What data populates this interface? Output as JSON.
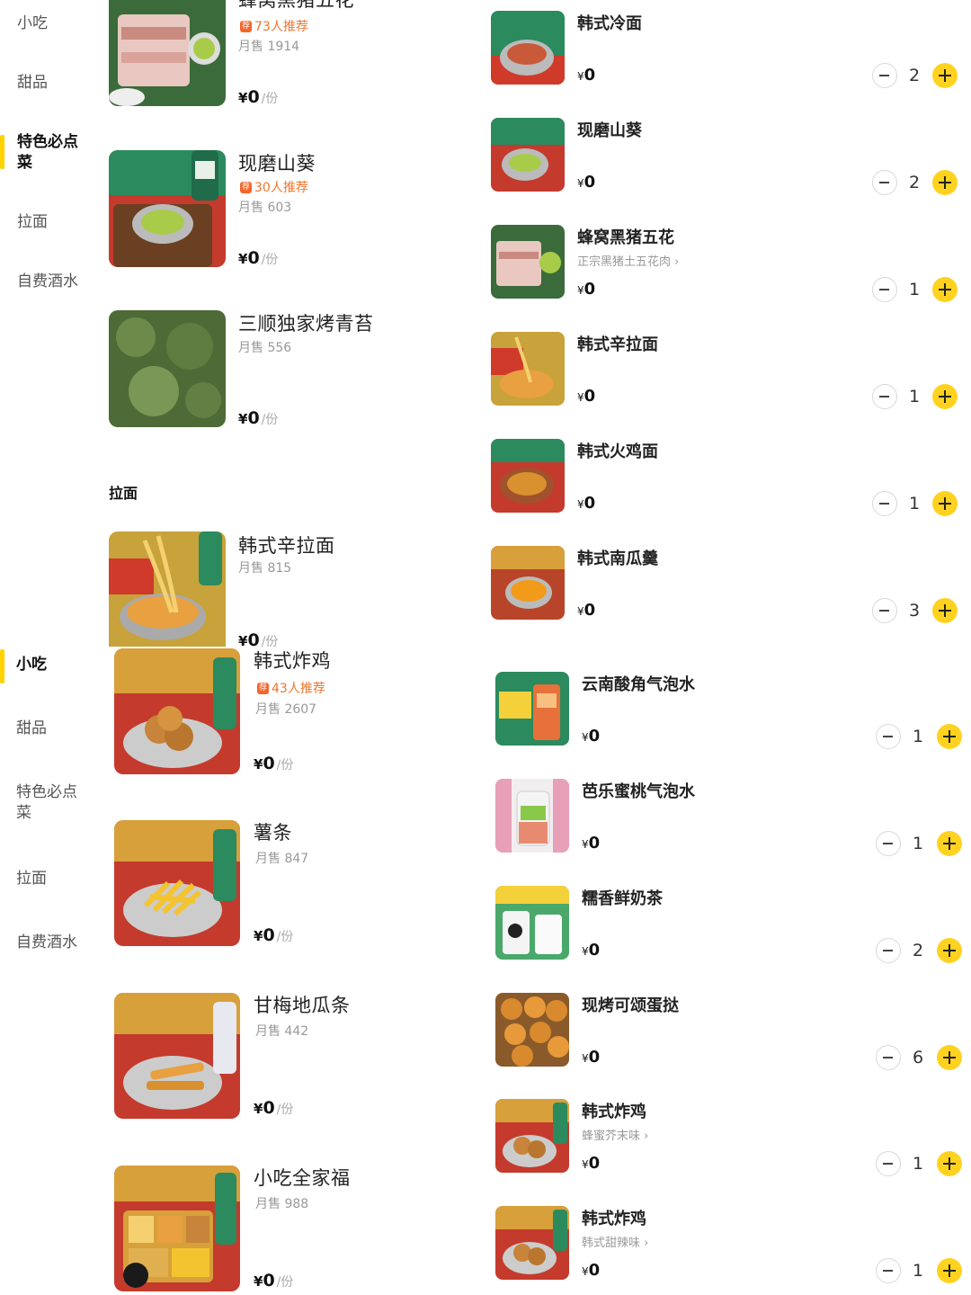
{
  "top_panel": {
    "nav": [
      "小吃",
      "甜品",
      "特色必点菜",
      "拉面",
      "自费酒水"
    ],
    "active_nav": "特色必点菜",
    "items": [
      {
        "name": "蜂窝黑猪五花",
        "rec": "73人推荐",
        "sales": "月售 1914",
        "price": "0",
        "unit": "/份"
      },
      {
        "name": "现磨山葵",
        "rec": "30人推荐",
        "sales": "月售 603",
        "price": "0",
        "unit": "/份"
      },
      {
        "name": "三顺独家烤青苔",
        "rec": "",
        "sales": "月售 556",
        "price": "0",
        "unit": "/份"
      }
    ],
    "section_title": "拉面",
    "section_items": [
      {
        "name": "韩式辛拉面",
        "rec": "",
        "sales": "月售 815",
        "price": "0",
        "unit": "/份"
      }
    ],
    "cart": [
      {
        "name": "韩式冷面",
        "sub": "",
        "price": "0",
        "qty": "2"
      },
      {
        "name": "现磨山葵",
        "sub": "",
        "price": "0",
        "qty": "2"
      },
      {
        "name": "蜂窝黑猪五花",
        "sub": "正宗黑猪土五花肉 ›",
        "price": "0",
        "qty": "1"
      },
      {
        "name": "韩式辛拉面",
        "sub": "",
        "price": "0",
        "qty": "1"
      },
      {
        "name": "韩式火鸡面",
        "sub": "",
        "price": "0",
        "qty": "1"
      },
      {
        "name": "韩式南瓜羹",
        "sub": "",
        "price": "0",
        "qty": "3"
      }
    ]
  },
  "bottom_panel": {
    "nav": [
      "小吃",
      "甜品",
      "特色必点菜",
      "拉面",
      "自费酒水"
    ],
    "active_nav": "小吃",
    "items": [
      {
        "name": "韩式炸鸡",
        "rec": "43人推荐",
        "sales": "月售 2607",
        "price": "0",
        "unit": "/份"
      },
      {
        "name": "薯条",
        "rec": "",
        "sales": "月售 847",
        "price": "0",
        "unit": "/份"
      },
      {
        "name": "甘梅地瓜条",
        "rec": "",
        "sales": "月售 442",
        "price": "0",
        "unit": "/份"
      },
      {
        "name": "小吃全家福",
        "rec": "",
        "sales": "月售 988",
        "price": "0",
        "unit": "/份"
      }
    ],
    "cart": [
      {
        "name": "云南酸角气泡水",
        "sub": "",
        "price": "0",
        "qty": "1"
      },
      {
        "name": "芭乐蜜桃气泡水",
        "sub": "",
        "price": "0",
        "qty": "1"
      },
      {
        "name": "糯香鲜奶茶",
        "sub": "",
        "price": "0",
        "qty": "2"
      },
      {
        "name": "现烤可颂蛋挞",
        "sub": "",
        "price": "0",
        "qty": "6"
      },
      {
        "name": "韩式炸鸡",
        "sub": "蜂蜜芥末味 ›",
        "price": "0",
        "qty": "1"
      },
      {
        "name": "韩式炸鸡",
        "sub": "韩式甜辣味 ›",
        "price": "0",
        "qty": "1"
      }
    ]
  },
  "currency": "¥",
  "colors": {
    "accent": "#ffd21f",
    "recommend": "#f0762e"
  }
}
